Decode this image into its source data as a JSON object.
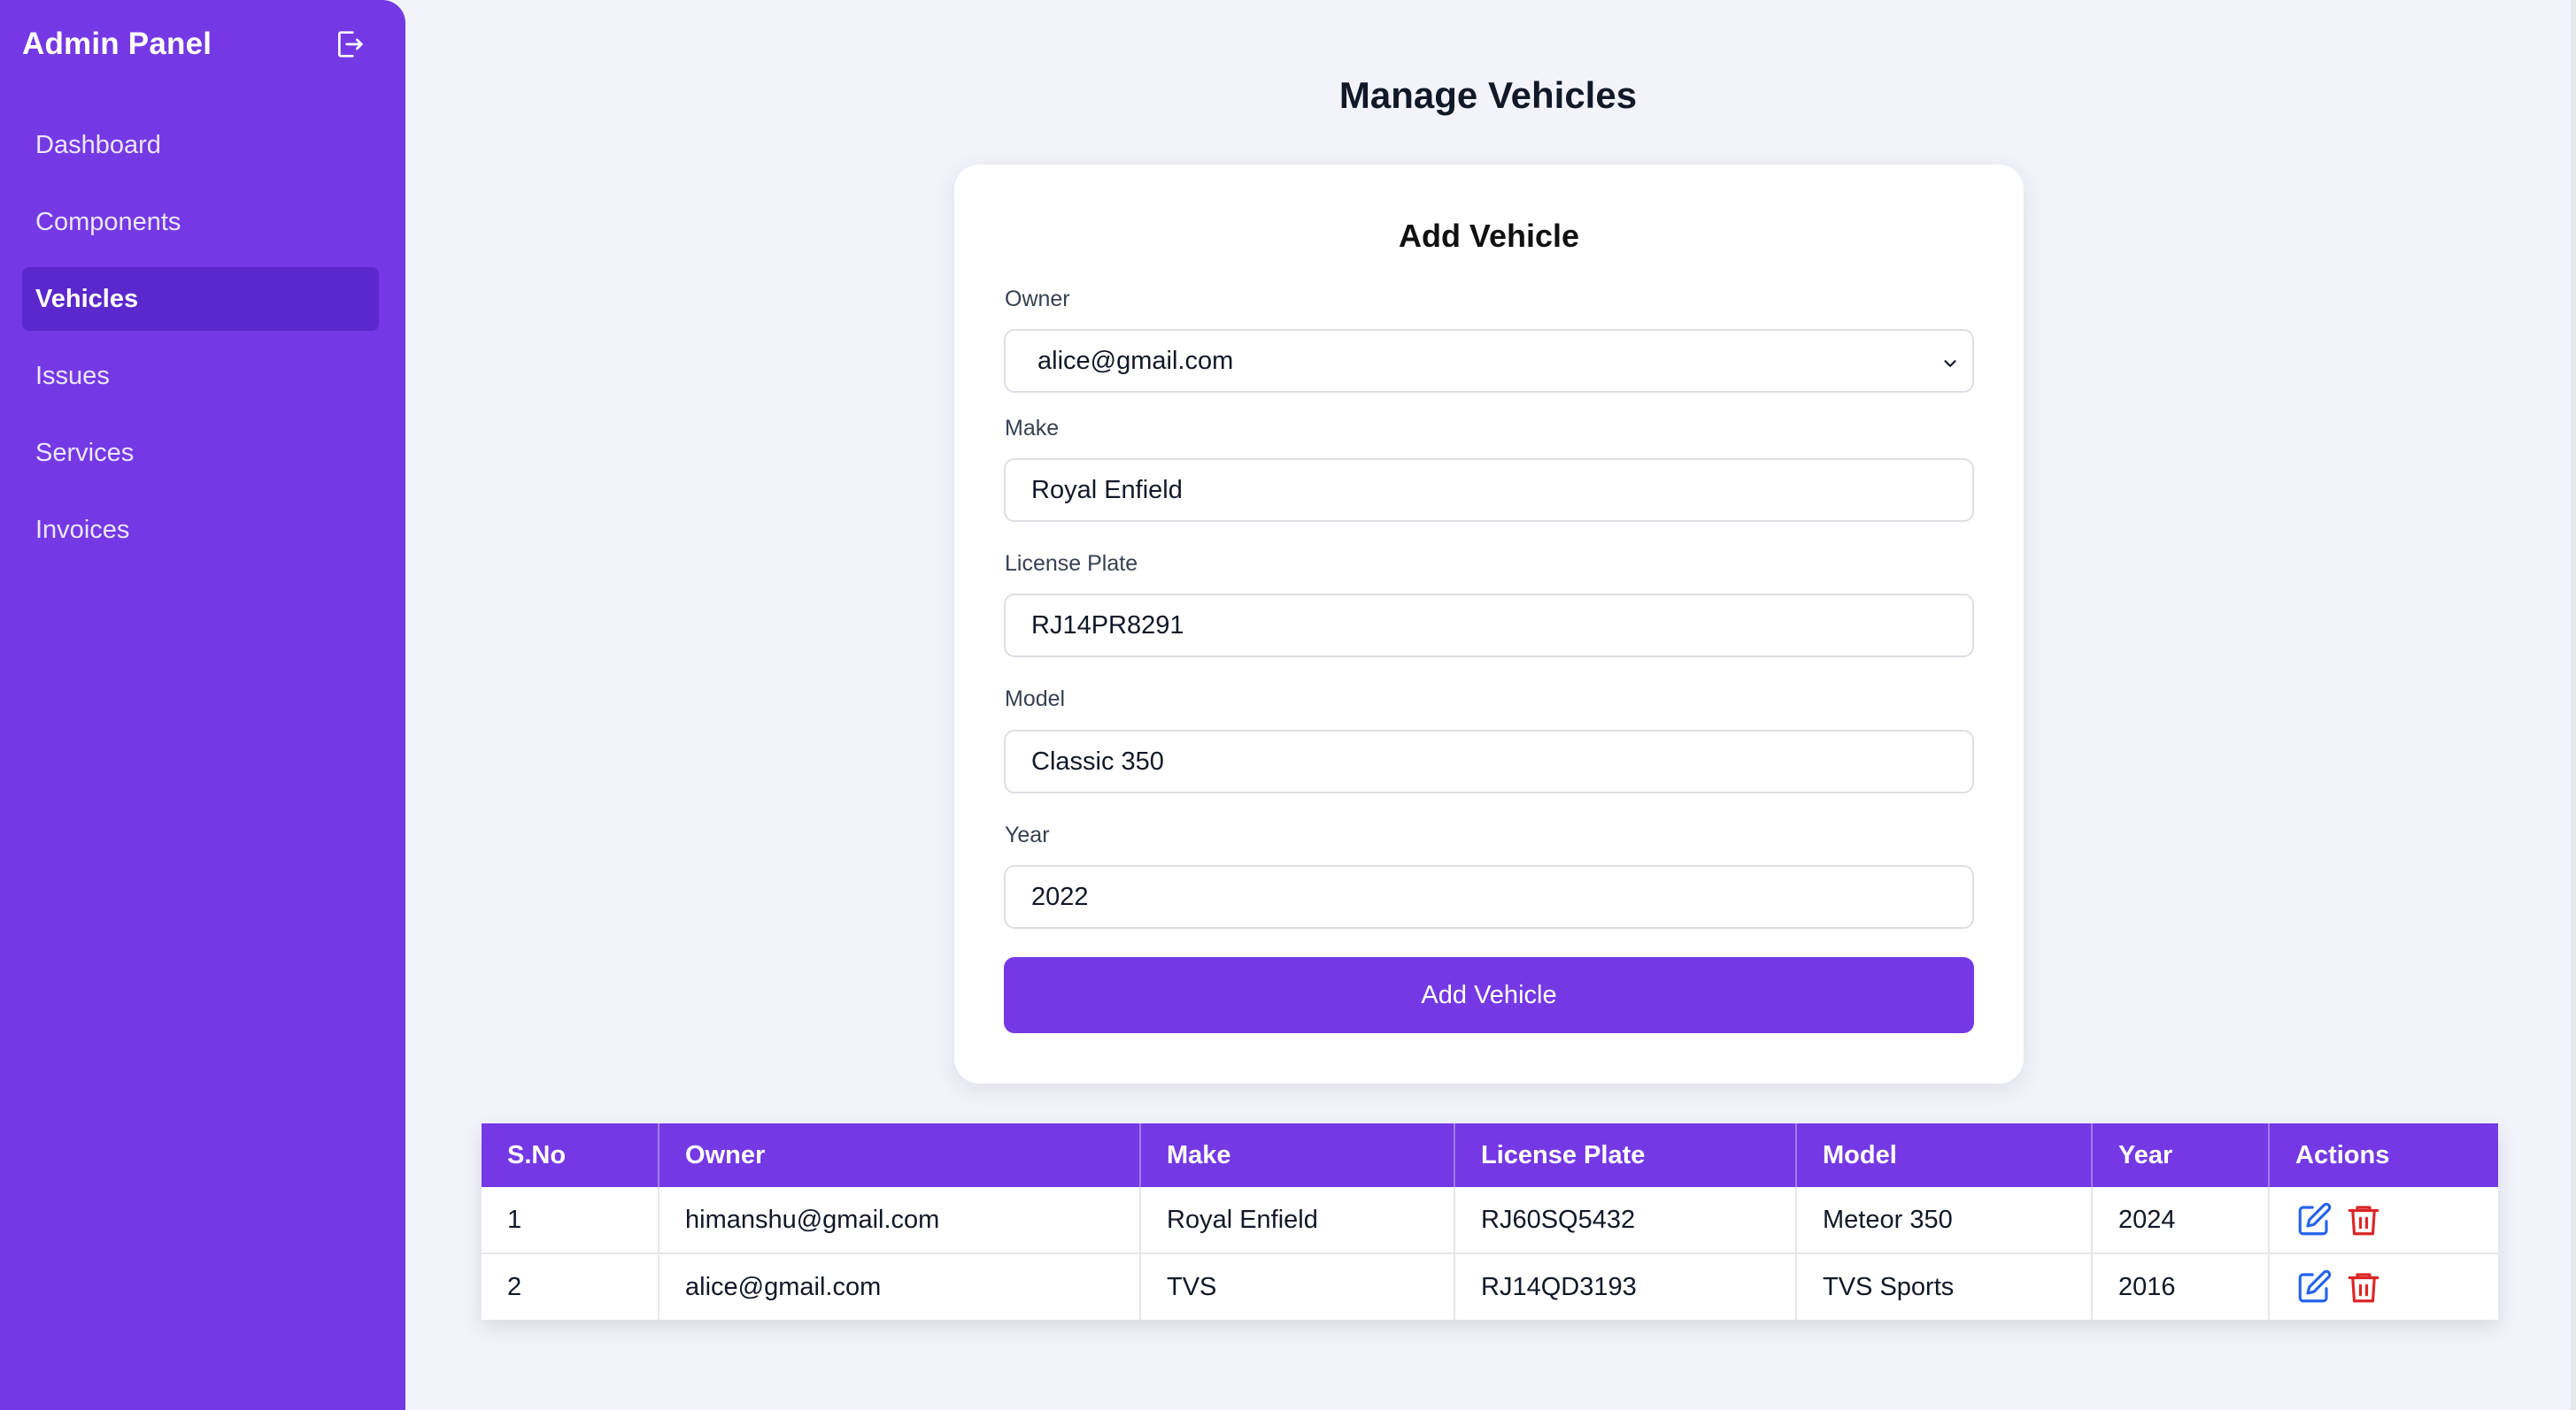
{
  "sidebar": {
    "brand": "Admin Panel",
    "logout_icon": "logout-icon",
    "items": [
      {
        "label": "Dashboard",
        "active": false
      },
      {
        "label": "Components",
        "active": false
      },
      {
        "label": "Vehicles",
        "active": true
      },
      {
        "label": "Issues",
        "active": false
      },
      {
        "label": "Services",
        "active": false
      },
      {
        "label": "Invoices",
        "active": false
      }
    ]
  },
  "page": {
    "title": "Manage Vehicles"
  },
  "form": {
    "title": "Add Vehicle",
    "owner_label": "Owner",
    "owner_value": "alice@gmail.com",
    "make_label": "Make",
    "make_value": "Royal Enfield",
    "plate_label": "License Plate",
    "plate_value": "RJ14PR8291",
    "model_label": "Model",
    "model_value": "Classic 350",
    "year_label": "Year",
    "year_value": "2022",
    "submit_label": "Add Vehicle"
  },
  "table": {
    "headers": [
      "S.No",
      "Owner",
      "Make",
      "License Plate",
      "Model",
      "Year",
      "Actions"
    ],
    "rows": [
      {
        "sno": "1",
        "owner": "himanshu@gmail.com",
        "make": "Royal Enfield",
        "plate": "RJ60SQ5432",
        "model": "Meteor 350",
        "year": "2024"
      },
      {
        "sno": "2",
        "owner": "alice@gmail.com",
        "make": "TVS",
        "plate": "RJ14QD3193",
        "model": "TVS Sports",
        "year": "2016"
      }
    ]
  },
  "colors": {
    "primary": "#7439e4",
    "active": "#5a28cc",
    "edit": "#2563eb",
    "delete": "#dc2626"
  }
}
